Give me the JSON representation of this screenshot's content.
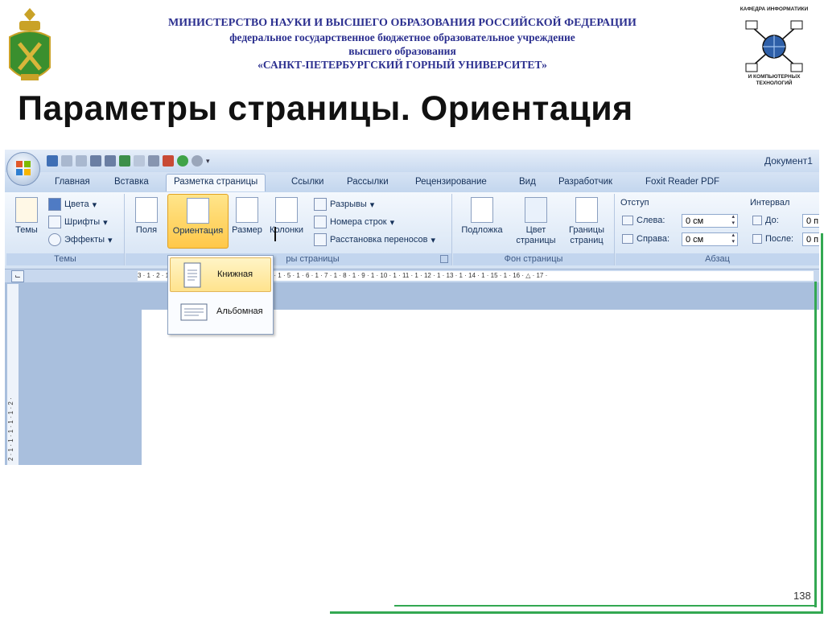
{
  "header": {
    "line1": "МИНИСТЕРСТВО НАУКИ И ВЫСШЕГО ОБРАЗОВАНИЯ РОССИЙСКОЙ ФЕДЕРАЦИИ",
    "line2": "федеральное государственное бюджетное образовательное учреждение",
    "line3": "высшего образования",
    "line4": "«САНКТ-ПЕТЕРБУРГСКИЙ ГОРНЫЙ УНИВЕРСИТЕТ»",
    "dept_top": "КАФЕДРА ИНФОРМАТИКИ",
    "dept_bottom": "И КОМПЬЮТЕРНЫХ ТЕХНОЛОГИЙ"
  },
  "slide_title": "Параметры страницы. Ориентация",
  "word": {
    "doc_title": "Документ1",
    "tabs": [
      "Главная",
      "Вставка",
      "Разметка страницы",
      "Ссылки",
      "Рассылки",
      "Рецензирование",
      "Вид",
      "Разработчик",
      "Foxit Reader PDF"
    ],
    "active_tab": "Разметка страницы",
    "ribbon": {
      "themes": {
        "big": "Темы",
        "colors": "Цвета",
        "fonts": "Шрифты",
        "effects": "Эффекты",
        "label": "Темы"
      },
      "page_setup": {
        "margins": "Поля",
        "orientation": "Ориентация",
        "size": "Размер",
        "columns": "Колонки",
        "breaks": "Разрывы",
        "line_numbers": "Номера строк",
        "hyphenation": "Расстановка переносов",
        "label": "ры страницы"
      },
      "page_bg": {
        "watermark": "Подложка",
        "color_l1": "Цвет",
        "color_l2": "страницы",
        "borders_l1": "Границы",
        "borders_l2": "страниц",
        "label": "Фон страницы"
      },
      "paragraph": {
        "indent_title": "Отступ",
        "left_label": "Слева:",
        "left_value": "0 см",
        "right_label": "Справа:",
        "right_value": "0 см",
        "spacing_title": "Интервал",
        "before_label": "До:",
        "before_value": "0 п",
        "after_label": "После:",
        "after_value": "0 п",
        "label": "Абзац"
      }
    },
    "orientation_menu": {
      "portrait": "Книжная",
      "landscape": "Альбомная"
    },
    "ruler_text": "3 · 1 · 2 · 1 · 1 · 1 · X · 1 · 1 · 1 · 2 · 1 · 3 · 1 · 4 · 1 · 5 · 1 · 6 · 1 · 7 · 1 · 8 · 1 · 9 · 1 · 10 · 1 · 11 · 1 · 12 · 1 · 13 · 1 · 14 · 1 · 15 · 1 · 16 · △ · 17 ·",
    "vruler_text": "2 · 1 · 1 · 1 · 1 · 1 · 2 ·"
  },
  "page_number": "138",
  "colors": {
    "header_text": "#2b2f8f",
    "frame_green": "#33a852",
    "ribbon_bg": "#dfe9f5",
    "selected": "#ffc84a"
  }
}
